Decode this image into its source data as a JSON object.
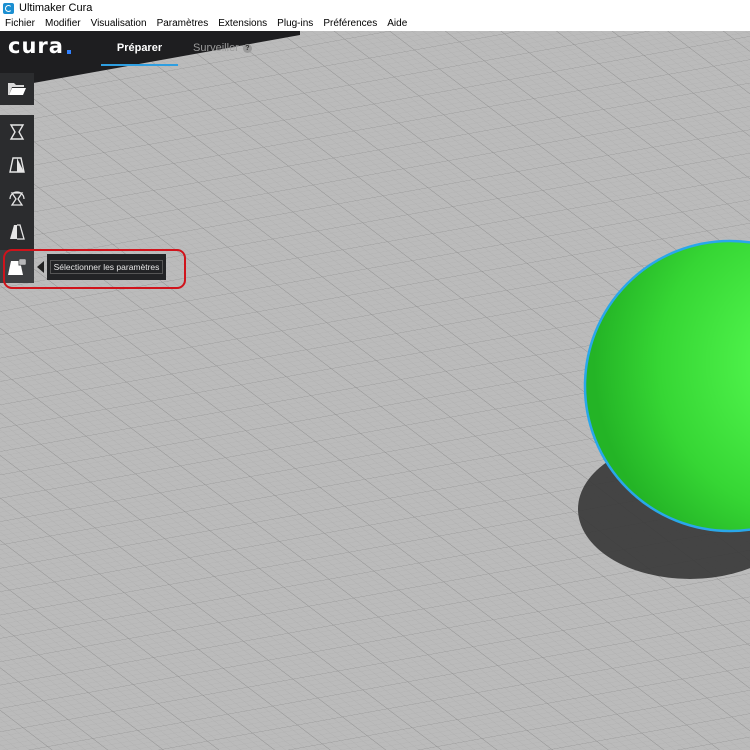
{
  "window": {
    "title": "Ultimaker Cura",
    "icon": "cura-app-icon"
  },
  "menubar": {
    "items": [
      "Fichier",
      "Modifier",
      "Visualisation",
      "Paramètres",
      "Extensions",
      "Plug-ins",
      "Préférences",
      "Aide"
    ]
  },
  "header": {
    "logo": "cura",
    "tabs": [
      {
        "label": "Préparer",
        "active": true
      },
      {
        "label": "Surveiller",
        "active": false
      }
    ]
  },
  "toolbar": {
    "open_icon": "folder-open-icon",
    "tools": [
      "move-tool-icon",
      "scale-tool-icon",
      "rotate-tool-icon",
      "mirror-tool-icon",
      "per-model-settings-icon"
    ],
    "active_tool": 4
  },
  "tooltip": {
    "text": "Sélectionner les paramètres"
  },
  "colors": {
    "header_bg": "#1e1e20",
    "toolbar_bg": "#2b2c2e",
    "accent_blue": "#2e9ee0",
    "model_green": "#37e63a",
    "model_outline": "#2aa7ea",
    "highlight_red": "#d0131b",
    "buildplate": "#bababa"
  }
}
